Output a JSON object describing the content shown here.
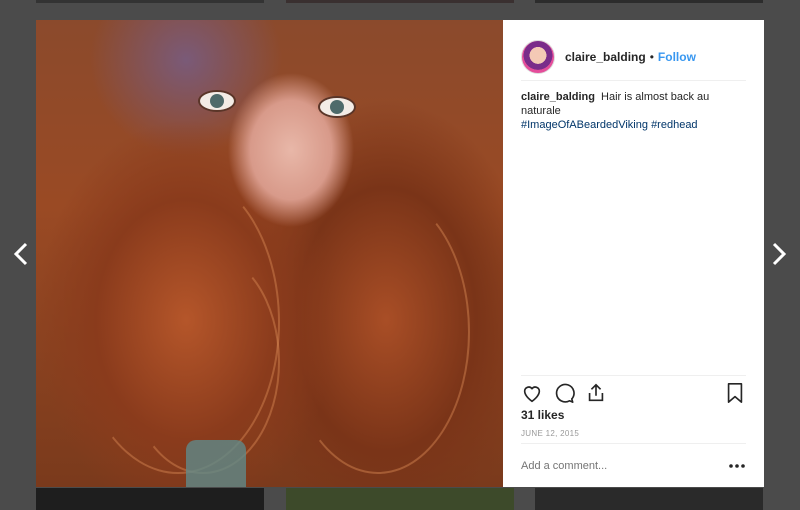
{
  "post": {
    "username": "claire_balding",
    "dot": "•",
    "follow_label": "Follow",
    "caption_text": "Hair is almost back au naturale",
    "hashtags": [
      "#ImageOfABeardedViking",
      "#redhead"
    ],
    "likes": "31 likes",
    "date": "JUNE 12, 2015",
    "comment_placeholder": "Add a comment..."
  },
  "icons": {
    "prev": "chevron-left-icon",
    "next": "chevron-right-icon",
    "like": "heart-icon",
    "comment": "comment-bubble-icon",
    "share": "share-icon",
    "save": "bookmark-icon",
    "more": "more-options-icon"
  },
  "colors": {
    "overlay": "#4b4b4b",
    "link": "#3897f0",
    "hashtag": "#003569"
  }
}
